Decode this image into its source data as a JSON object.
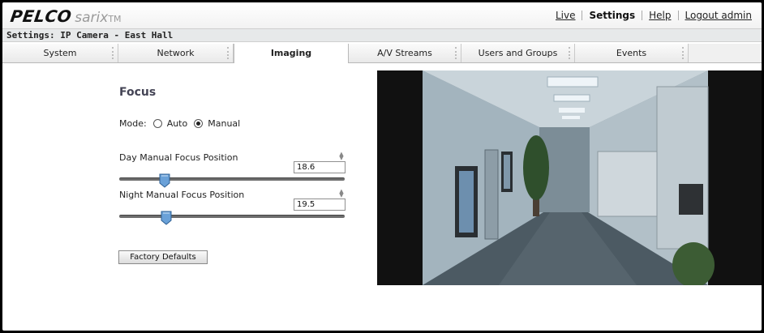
{
  "brand": {
    "name": "PELCO",
    "product": "sarix",
    "tm": "TM"
  },
  "topnav": {
    "live": "Live",
    "settings": "Settings",
    "help": "Help",
    "logout": "Logout admin"
  },
  "breadcrumb": "Settings: IP Camera - East Hall",
  "tabs": [
    "System",
    "Network",
    "Imaging",
    "A/V Streams",
    "Users and Groups",
    "Events"
  ],
  "focus": {
    "title": "Focus",
    "mode_label": "Mode:",
    "mode_auto": "Auto",
    "mode_manual": "Manual",
    "selected_mode": "Manual",
    "day": {
      "label": "Day Manual Focus Position",
      "value": "18.6",
      "level": 0.2
    },
    "night": {
      "label": "Night Manual Focus Position",
      "value": "19.5",
      "level": 0.21
    },
    "factory_defaults": "Factory Defaults"
  },
  "colors": {
    "accent_tab_text": "#111111",
    "slider_thumb": "#6aa1d8"
  }
}
